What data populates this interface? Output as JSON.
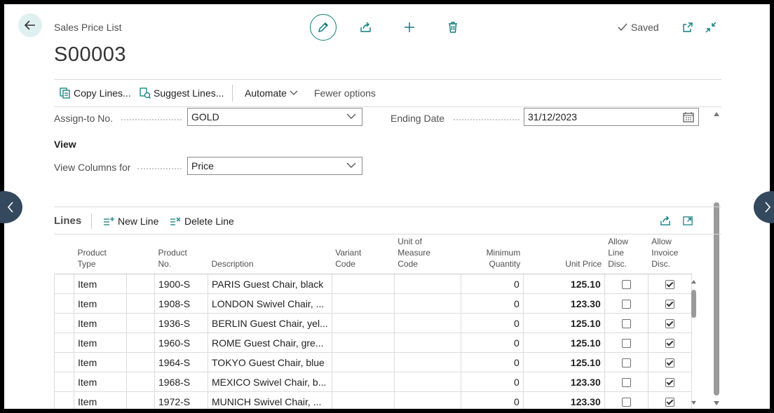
{
  "header": {
    "caption": "Sales Price List",
    "record_no": "S00003",
    "saved_label": "Saved"
  },
  "actions": {
    "copy_lines": "Copy Lines...",
    "suggest_lines": "Suggest Lines...",
    "automate": "Automate",
    "fewer_options": "Fewer options"
  },
  "fields": {
    "assign_to_no_label": "Assign-to No.",
    "assign_to_no_value": "GOLD",
    "ending_date_label": "Ending Date",
    "ending_date_value": "31/12/2023",
    "view_heading": "View",
    "view_columns_label": "View Columns for",
    "view_columns_value": "Price"
  },
  "lines": {
    "title": "Lines",
    "new_line": "New Line",
    "delete_line": "Delete Line",
    "columns": {
      "product_type": [
        "Product",
        "Type"
      ],
      "product_no": [
        "Product",
        "No."
      ],
      "description": [
        "Description"
      ],
      "variant_code": [
        "Variant",
        "Code"
      ],
      "uom_code": [
        "Unit of",
        "Measure",
        "Code"
      ],
      "min_qty": [
        "Minimum",
        "Quantity"
      ],
      "unit_price": [
        "Unit Price"
      ],
      "allow_line_disc": [
        "Allow",
        "Line",
        "Disc."
      ],
      "allow_invoice_disc": [
        "Allow",
        "Invoice",
        "Disc."
      ]
    },
    "rows": [
      {
        "type": "Item",
        "no": "1900-S",
        "desc": "PARIS Guest Chair, black",
        "variant": "",
        "uom": "",
        "min_qty": "0",
        "price": "125.10",
        "line_disc": false,
        "inv_disc": true
      },
      {
        "type": "Item",
        "no": "1908-S",
        "desc": "LONDON Swivel Chair, ...",
        "variant": "",
        "uom": "",
        "min_qty": "0",
        "price": "123.30",
        "line_disc": false,
        "inv_disc": true
      },
      {
        "type": "Item",
        "no": "1936-S",
        "desc": "BERLIN Guest Chair, yel...",
        "variant": "",
        "uom": "",
        "min_qty": "0",
        "price": "125.10",
        "line_disc": false,
        "inv_disc": true
      },
      {
        "type": "Item",
        "no": "1960-S",
        "desc": "ROME Guest Chair, gre...",
        "variant": "",
        "uom": "",
        "min_qty": "0",
        "price": "125.10",
        "line_disc": false,
        "inv_disc": true
      },
      {
        "type": "Item",
        "no": "1964-S",
        "desc": "TOKYO Guest Chair, blue",
        "variant": "",
        "uom": "",
        "min_qty": "0",
        "price": "125.10",
        "line_disc": false,
        "inv_disc": true
      },
      {
        "type": "Item",
        "no": "1968-S",
        "desc": "MEXICO Swivel Chair, b...",
        "variant": "",
        "uom": "",
        "min_qty": "0",
        "price": "123.30",
        "line_disc": false,
        "inv_disc": true
      },
      {
        "type": "Item",
        "no": "1972-S",
        "desc": "MUNICH Swivel Chair, ...",
        "variant": "",
        "uom": "",
        "min_qty": "0",
        "price": "123.30",
        "line_disc": false,
        "inv_disc": true
      }
    ]
  },
  "colors": {
    "accent": "#0f7d7d",
    "nav_circle": "#34495e"
  }
}
